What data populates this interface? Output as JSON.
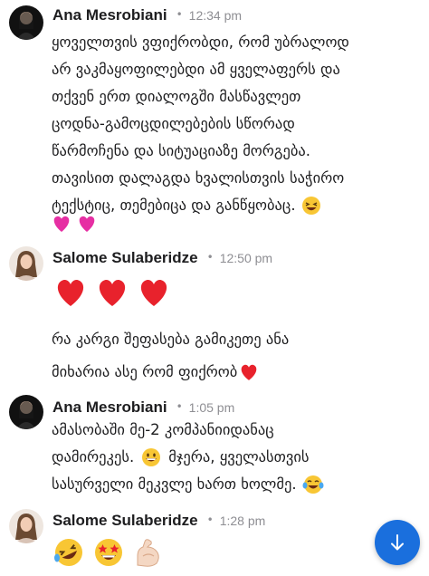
{
  "messages": [
    {
      "author": "Ana Mesrobiani",
      "time": "12:34 pm",
      "lines": [
        "ყოველთვის ვფიქრობდი, რომ უბრალოდ",
        "არ ვაკმაყოფილებდი ამ ყველაფერს და",
        "თქვენ ერთ დიალოგში მასწავლეთ",
        "ცოდნა-გამოცდილებების სწორად",
        "წარმოჩენა და სიტუაციაზე მორგება.",
        "თავისით დალაგდა ხვალისთვის საჭირო",
        "ტექსტიც, თემებიცა და განწყობაც."
      ],
      "trailing_emoji": "laughing-face",
      "extra_emojis": [
        "pink-hearts",
        "pink-hearts"
      ]
    },
    {
      "author": "Salome Sulaberidze",
      "time": "12:50 pm",
      "emojis": [
        "red-heart",
        "red-heart",
        "red-heart"
      ],
      "lines": [
        "რა კარგი შეფასება გამიკეთე ანა",
        "მიხარია ასე რომ ფიქრობ"
      ],
      "trailing_emoji": "red-heart"
    },
    {
      "author": "Ana Mesrobiani",
      "time": "1:05 pm",
      "lines": [
        "ამასობაში მე-2 კომპანიიდანაც",
        "დამირეკეს.",
        "მჯერა, ყველასთვის",
        "სასურველი მეკვლე ხართ ხოლმე."
      ],
      "inline_emojis": [
        "grinning-face",
        "tears-of-joy-face"
      ]
    },
    {
      "author": "Salome Sulaberidze",
      "time": "1:28 pm",
      "emojis": [
        "rofl-face",
        "star-struck-face",
        "flexed-biceps"
      ]
    }
  ],
  "separator": "•",
  "colors": {
    "accent": "#1a6fdd",
    "muted": "#8e8e93",
    "heart": "#e8222c",
    "pink": "#e62fa3",
    "emoji_yellow": "#f8c634"
  },
  "scroll_button": {
    "icon": "arrow-down-icon"
  }
}
